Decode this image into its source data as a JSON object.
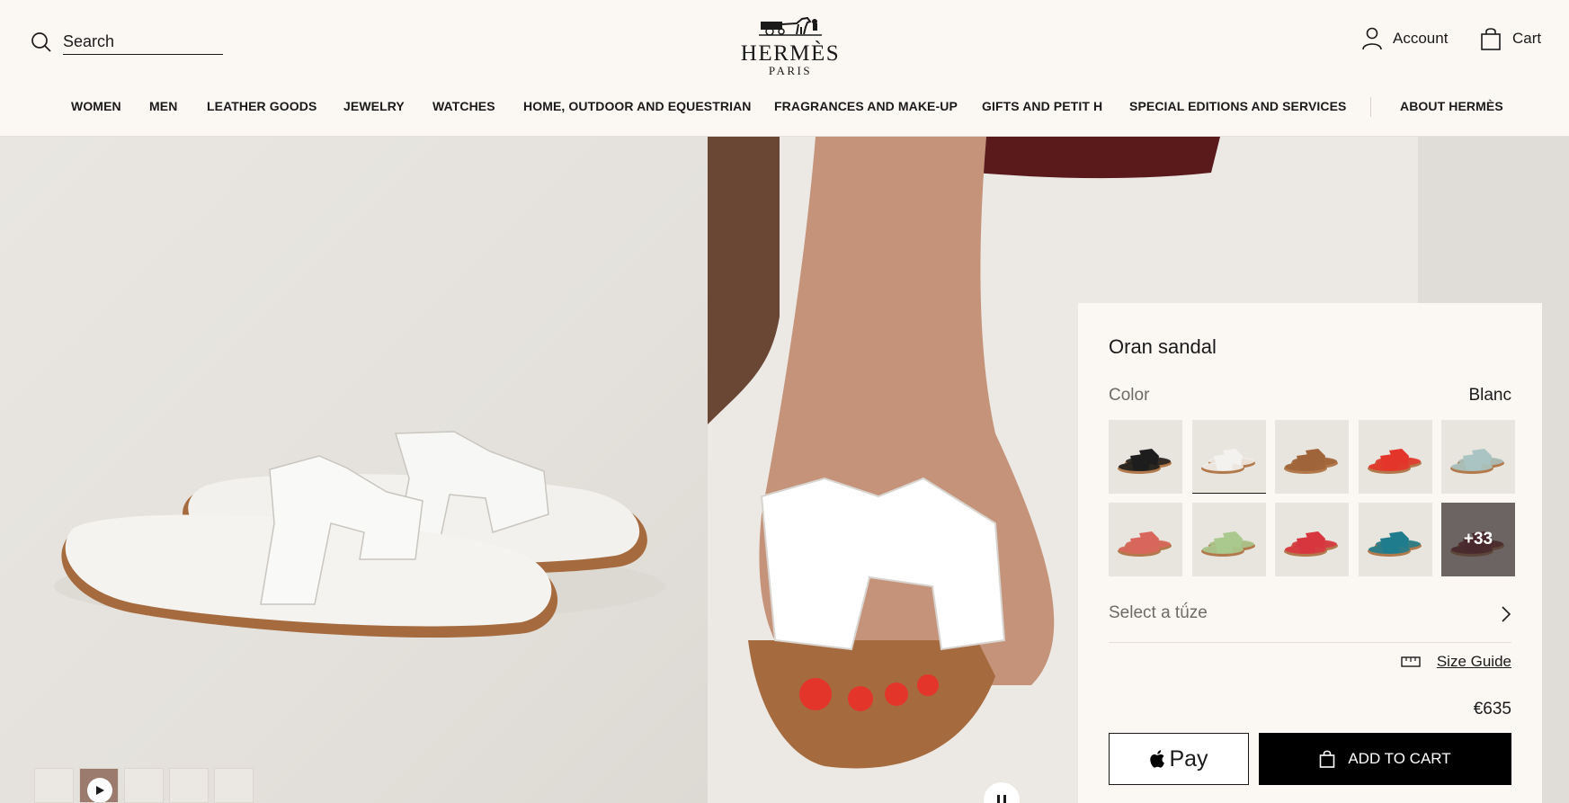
{
  "header": {
    "search_placeholder": "Search",
    "brand": "HERMÈS",
    "city": "PARIS",
    "account_label": "Account",
    "cart_label": "Cart"
  },
  "nav": [
    "WOMEN",
    "MEN",
    "LEATHER GOODS",
    "JEWELRY",
    "WATCHES",
    "HOME, OUTDOOR AND EQUESTRIAN",
    "FRAGRANCES AND MAKE-UP",
    "GIFTS AND PETIT H",
    "SPECIAL EDITIONS AND SERVICES",
    "ABOUT HERMÈS"
  ],
  "product": {
    "name": "Oran sandal",
    "color_label": "Color",
    "color_value": "Blanc",
    "swatch_colors": [
      "#1d1d1d",
      "#f3f2ef",
      "#a0643a",
      "#e4352b",
      "#a9c4c2",
      "#d9665c",
      "#a9c98f",
      "#d8363f",
      "#1f7c8c",
      "#6b1524"
    ],
    "more_colors": "+33",
    "size_label": "Select a tǘze",
    "size_guide": "Size Guide",
    "price": "€635",
    "apple_pay": "Pay",
    "add_to_cart": "ADD TO CART"
  },
  "accent_colors": {
    "background": "#fbf8f4",
    "button": "#000000"
  }
}
